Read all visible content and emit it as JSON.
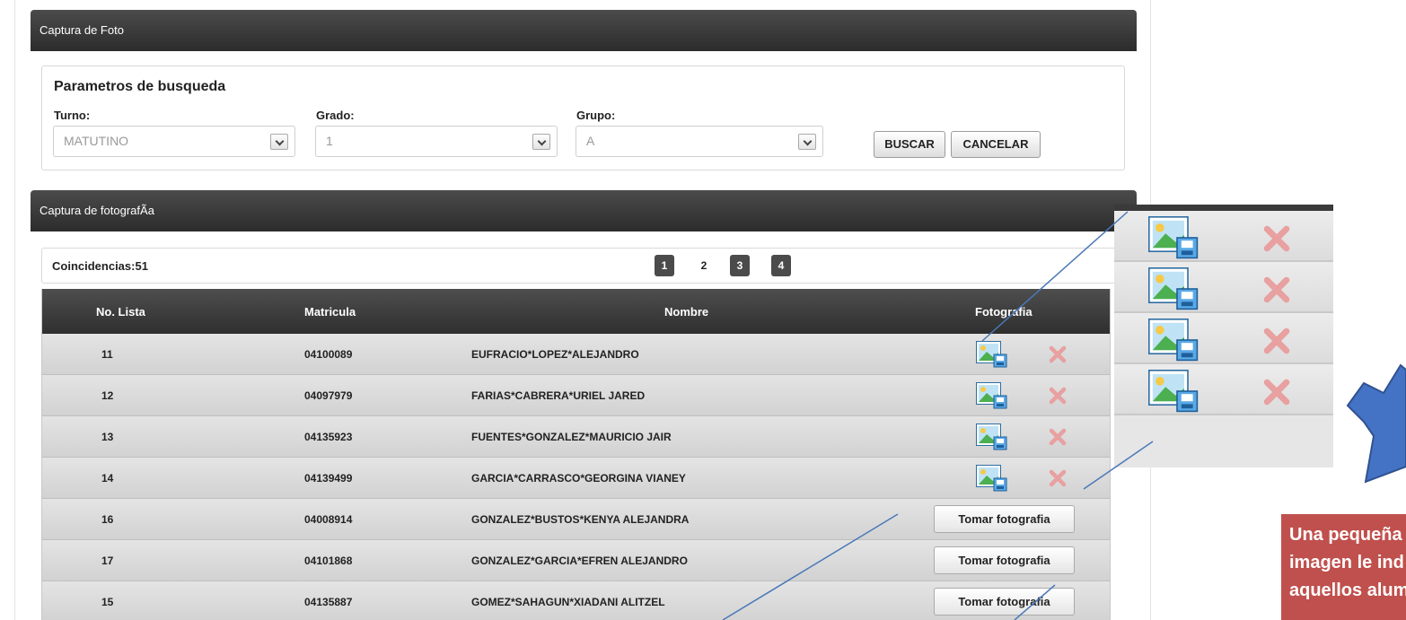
{
  "panel": {
    "title": "Captura de Foto"
  },
  "search": {
    "title": "Parametros de busqueda",
    "turno_label": "Turno:",
    "turno_value": "MATUTINO",
    "grado_label": "Grado:",
    "grado_value": "1",
    "grupo_label": "Grupo:",
    "grupo_value": "A",
    "buscar_label": "BUSCAR",
    "cancelar_label": "CANCELAR"
  },
  "capture": {
    "title": "Captura de fotografÃa",
    "count_label": "Coincidencias:51",
    "pages": [
      "1",
      "2",
      "3",
      "4"
    ],
    "current_page": "2"
  },
  "table": {
    "headers": [
      "No. Lista",
      "Matricula",
      "Nombre",
      "Fotografia"
    ],
    "rows": [
      {
        "no": "11",
        "matricula": "04100089",
        "nombre": "EUFRACIO*LOPEZ*ALEJANDRO",
        "status": "saved"
      },
      {
        "no": "12",
        "matricula": "04097979",
        "nombre": "FARIAS*CABRERA*URIEL JARED",
        "status": "saved"
      },
      {
        "no": "13",
        "matricula": "04135923",
        "nombre": "FUENTES*GONZALEZ*MAURICIO JAIR",
        "status": "saved"
      },
      {
        "no": "14",
        "matricula": "04139499",
        "nombre": "GARCIA*CARRASCO*GEORGINA VIANEY",
        "status": "saved"
      },
      {
        "no": "16",
        "matricula": "04008914",
        "nombre": "GONZALEZ*BUSTOS*KENYA ALEJANDRA",
        "status": "pending"
      },
      {
        "no": "17",
        "matricula": "04101868",
        "nombre": "GONZALEZ*GARCIA*EFREN ALEJANDRO",
        "status": "pending"
      },
      {
        "no": "15",
        "matricula": "04135887",
        "nombre": "GOMEZ*SAHAGUN*XIADANI ALITZEL",
        "status": "pending"
      }
    ],
    "take_photo_label": "Tomar fotografia"
  },
  "note": {
    "lines": [
      "Una pequeña",
      "imagen le ind",
      "aquellos alum"
    ]
  },
  "colors": {
    "header_dark": "#3a3a3a",
    "row_grey": "#d8d8d8",
    "delete_red": "#e8a0a0",
    "note_red": "#c0504d",
    "arrow_blue": "#4472c4",
    "line_blue": "#4a78b8"
  },
  "icons": {
    "photo": "save-photo-icon",
    "delete": "delete-x-icon",
    "select": "chevron-down-icon"
  }
}
